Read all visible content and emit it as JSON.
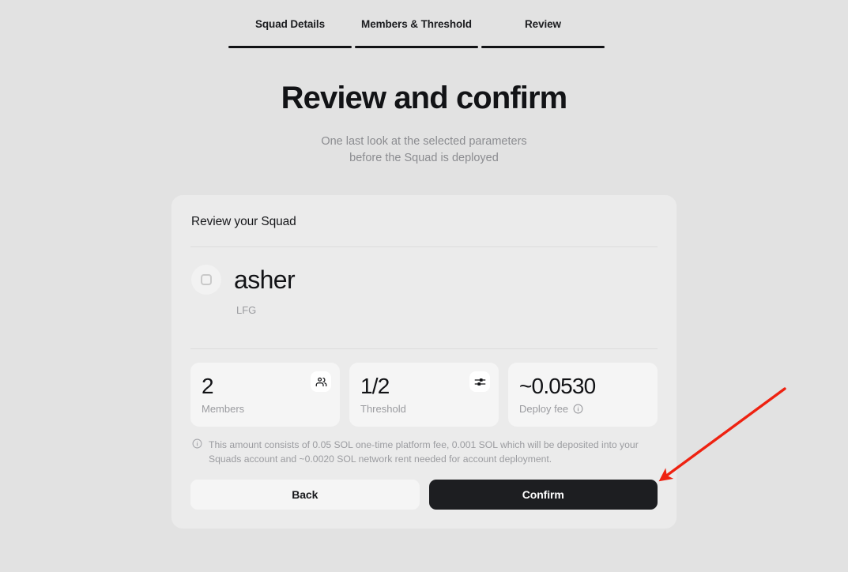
{
  "stepper": {
    "steps": [
      {
        "label": "Squad Details",
        "state": "complete"
      },
      {
        "label": "Members & Threshold",
        "state": "complete"
      },
      {
        "label": "Review",
        "state": "active"
      }
    ]
  },
  "hero": {
    "title": "Review and confirm",
    "subtitle_line1": "One last look at the selected parameters",
    "subtitle_line2": "before the Squad is deployed"
  },
  "card": {
    "title": "Review your Squad",
    "squad": {
      "name": "asher",
      "description": "LFG",
      "avatar_icon": "squad-placeholder-icon"
    },
    "stats": [
      {
        "value": "2",
        "label": "Members",
        "icon": "users-icon",
        "has_info": false
      },
      {
        "value": "1/2",
        "label": "Threshold",
        "icon": "sliders-icon",
        "has_info": false
      },
      {
        "value": "~0.0530",
        "label": "Deploy fee",
        "icon": null,
        "has_info": true
      }
    ],
    "disclaimer": "This amount consists of 0.05 SOL one-time platform fee, 0.001 SOL which will be deposited into your Squads account and ~0.0020 SOL network rent needed for account deployment.",
    "actions": {
      "back_label": "Back",
      "confirm_label": "Confirm"
    }
  },
  "annotation": {
    "arrow_color": "#ee2211"
  },
  "colors": {
    "page_background": "#e2e2e2",
    "card_background": "#ebebeb",
    "stat_background": "#f5f5f5",
    "confirm_background": "#1d1e21",
    "muted_text": "#9a9b9f",
    "primary_text": "#121316"
  }
}
